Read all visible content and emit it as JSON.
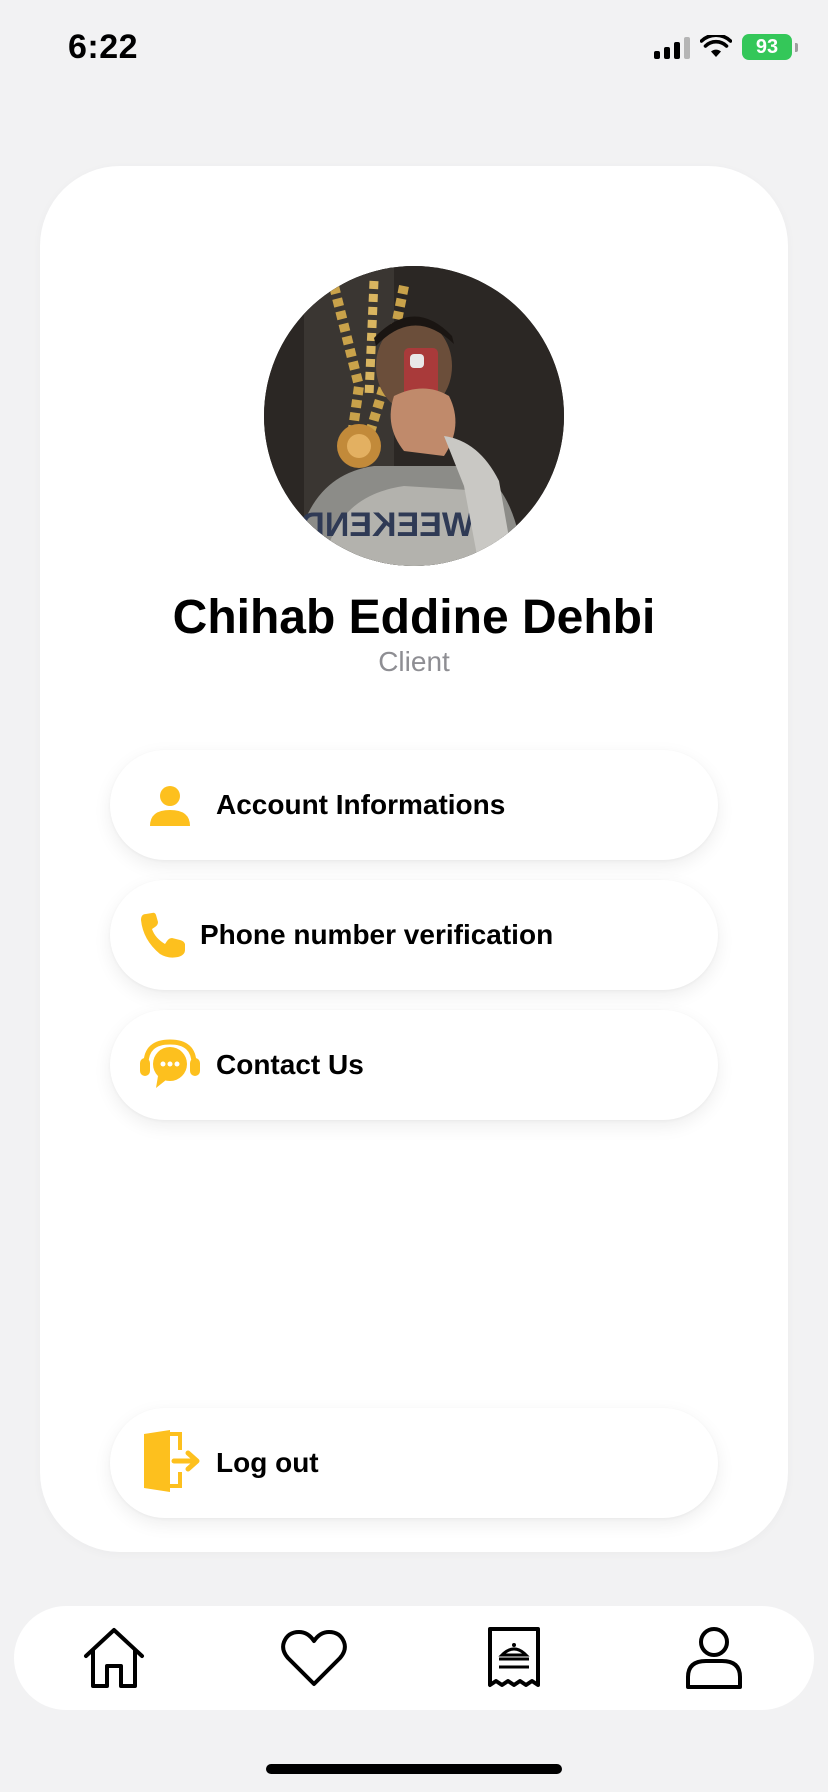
{
  "status_bar": {
    "time": "6:22",
    "battery_level": "93",
    "icons": [
      "signal-icon",
      "wifi-icon",
      "battery-icon"
    ]
  },
  "profile": {
    "name": "Chihab Eddine Dehbi",
    "role": "Client"
  },
  "menu": {
    "items": [
      {
        "label": "Account Informations",
        "icon": "person-icon"
      },
      {
        "label": "Phone number verification",
        "icon": "phone-icon"
      },
      {
        "label": "Contact Us",
        "icon": "support-chat-icon"
      }
    ],
    "logout_label": "Log out",
    "logout_icon": "logout-icon"
  },
  "tab_bar": {
    "items": [
      "home-icon",
      "heart-icon",
      "receipt-icon",
      "profile-icon"
    ],
    "active": "profile-icon"
  },
  "colors": {
    "accent": "#FDC01E",
    "background": "#F2F2F3",
    "card": "#FFFFFF",
    "battery": "#34C759",
    "secondary_text": "#8E8E93"
  }
}
